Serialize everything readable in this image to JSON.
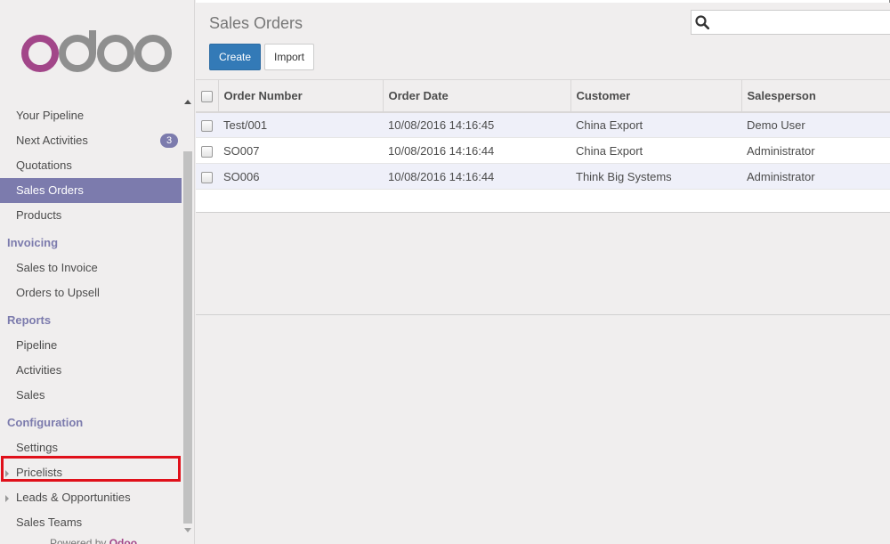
{
  "sidebar": {
    "menu": [
      {
        "type": "item",
        "label": "Your Pipeline"
      },
      {
        "type": "item",
        "label": "Next Activities",
        "badge": "3"
      },
      {
        "type": "item",
        "label": "Quotations"
      },
      {
        "type": "item",
        "label": "Sales Orders",
        "active": true
      },
      {
        "type": "item",
        "label": "Products"
      },
      {
        "type": "header",
        "label": "Invoicing"
      },
      {
        "type": "item",
        "label": "Sales to Invoice"
      },
      {
        "type": "item",
        "label": "Orders to Upsell"
      },
      {
        "type": "header",
        "label": "Reports"
      },
      {
        "type": "item",
        "label": "Pipeline"
      },
      {
        "type": "item",
        "label": "Activities"
      },
      {
        "type": "item",
        "label": "Sales"
      },
      {
        "type": "header",
        "label": "Configuration"
      },
      {
        "type": "item",
        "label": "Settings"
      },
      {
        "type": "item",
        "label": "Pricelists",
        "expandable": true
      },
      {
        "type": "item",
        "label": "Leads & Opportunities",
        "expandable": true
      },
      {
        "type": "item",
        "label": "Sales Teams"
      }
    ],
    "powered_prefix": "Powered by",
    "powered_brand": "Odoo"
  },
  "header": {
    "title": "Sales Orders",
    "create_label": "Create",
    "import_label": "Import",
    "search_placeholder": ""
  },
  "table": {
    "columns": [
      "Order Number",
      "Order Date",
      "Customer",
      "Salesperson"
    ],
    "rows": [
      [
        "Test/001",
        "10/08/2016 14:16:45",
        "China Export",
        "Demo User"
      ],
      [
        "SO007",
        "10/08/2016 14:16:44",
        "China Export",
        "Administrator"
      ],
      [
        "SO006",
        "10/08/2016 14:16:44",
        "Think Big Systems",
        "Administrator"
      ]
    ]
  },
  "colors": {
    "brand_purple": "#7c7bad",
    "logo_purple": "#a24689",
    "logo_gray": "#8f8f8f",
    "primary_button": "#337ab7",
    "highlight": "#e0101a"
  },
  "icons": {
    "search": "search-icon",
    "expand": "caret-right-icon",
    "scroll_up": "arrow-up-icon",
    "scroll_down": "arrow-down-icon"
  }
}
